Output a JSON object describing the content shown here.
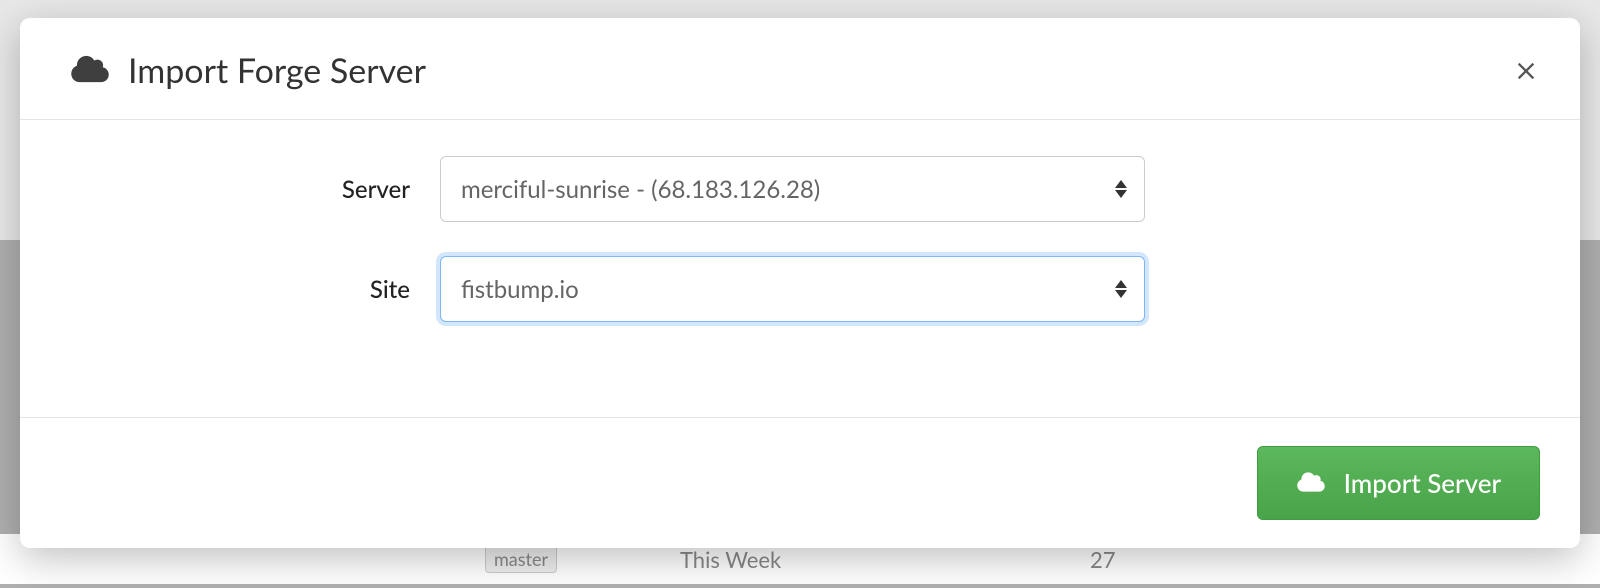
{
  "modal": {
    "title": "Import Forge Server",
    "form": {
      "server_label": "Server",
      "server_selected": "merciful-sunrise - (68.183.126.28)",
      "site_label": "Site",
      "site_selected": "fistbump.io"
    },
    "import_button_label": "Import Server"
  },
  "background": {
    "badge": "master",
    "text1": "This Week",
    "text2": "27"
  }
}
